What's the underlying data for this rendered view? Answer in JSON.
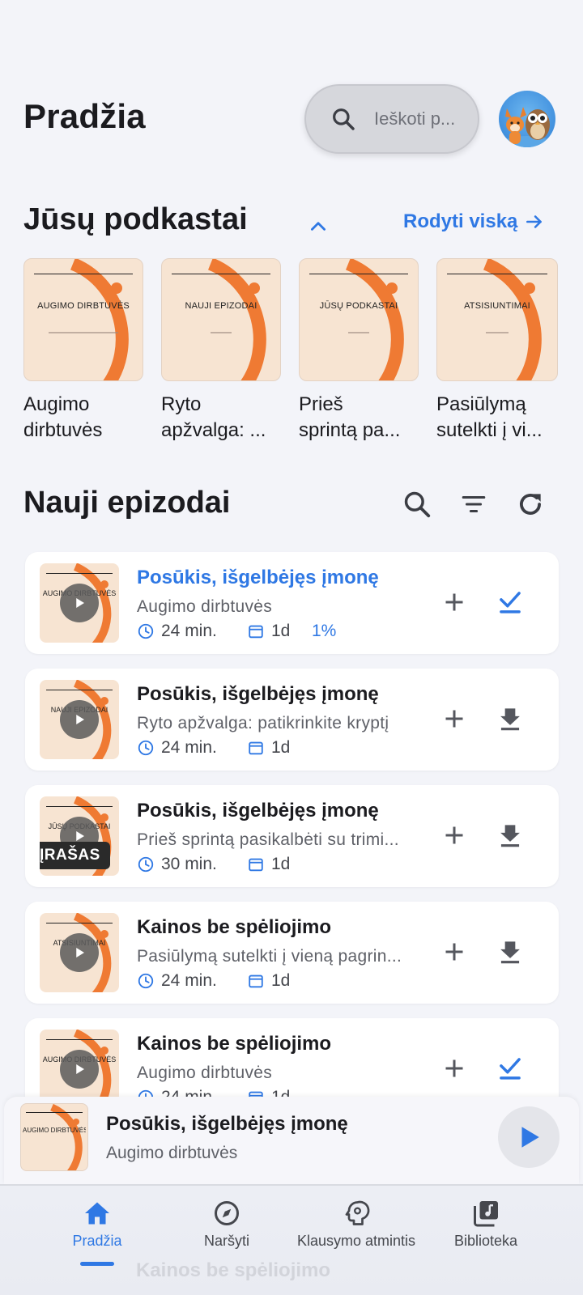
{
  "header": {
    "title": "Pradžia",
    "search_placeholder": "Ieškoti p..."
  },
  "podcasts_section": {
    "title": "Jūsų podkastai",
    "show_all": "Rodyti viską",
    "items": [
      {
        "cover_title": "AUGIMO DIRBTUVĖS",
        "label_line1": "Augimo",
        "label_line2": "dirbtuvės"
      },
      {
        "cover_title": "NAUJI EPIZODAI",
        "label_line1": "Ryto",
        "label_line2": "apžvalga: ..."
      },
      {
        "cover_title": "JŪSŲ PODKASTAI",
        "label_line1": "Prieš",
        "label_line2": "sprintą pa..."
      },
      {
        "cover_title": "ATSISIUNTIMAI",
        "label_line1": "Pasiūlymą",
        "label_line2": "sutelkti į vi..."
      }
    ]
  },
  "episodes_section": {
    "title": "Nauji epizodai",
    "items": [
      {
        "cover_title": "AUGIMO DIRBTUVĖS",
        "title": "Posūkis, išgelbėjęs įmonę",
        "subtitle": "Augimo dirbtuvės",
        "duration": "24 min.",
        "date": "1d",
        "progress": "1%",
        "action": "done",
        "active": true
      },
      {
        "cover_title": "NAUJI EPIZODAI",
        "title": "Posūkis, išgelbėjęs įmonę",
        "subtitle": "Ryto apžvalga: patikrinkite kryptį",
        "duration": "24 min.",
        "date": "1d",
        "action": "download"
      },
      {
        "cover_title": "JŪSŲ PODKASTAI",
        "title": "Posūkis, išgelbėjęs įmonę",
        "subtitle": "Prieš sprintą pasikalbėti su trimi...",
        "duration": "30 min.",
        "date": "1d",
        "badge": "ĮRAŠAS",
        "action": "download"
      },
      {
        "cover_title": "ATSISIUNTIMAI",
        "title": "Kainos be spėliojimo",
        "subtitle": "Pasiūlymą sutelkti į vieną pagrin...",
        "duration": "24 min.",
        "date": "1d",
        "action": "download"
      },
      {
        "cover_title": "AUGIMO DIRBTUVĖS",
        "title": "Kainos be spėliojimo",
        "subtitle": "Augimo dirbtuvės",
        "duration": "24 min.",
        "date": "1d",
        "action": "done"
      }
    ]
  },
  "mini_player": {
    "cover_title": "AUGIMO DIRBTUVĖS",
    "title": "Posūkis, išgelbėjęs įmonę",
    "subtitle": "Augimo dirbtuvės"
  },
  "bottom_nav": {
    "items": [
      {
        "label": "Pradžia",
        "icon": "home-icon",
        "active": true
      },
      {
        "label": "Naršyti",
        "icon": "compass-icon"
      },
      {
        "label": "Klausymo atmintis",
        "icon": "head-gear-icon"
      },
      {
        "label": "Biblioteka",
        "icon": "library-music-icon"
      }
    ]
  },
  "peek_text": "Kainos be spėliojimo",
  "colors": {
    "accent": "#2f78e4",
    "cover_bg": "#f7e4d2",
    "cover_arc": "#ef7a33",
    "background": "#f3f4f9"
  }
}
